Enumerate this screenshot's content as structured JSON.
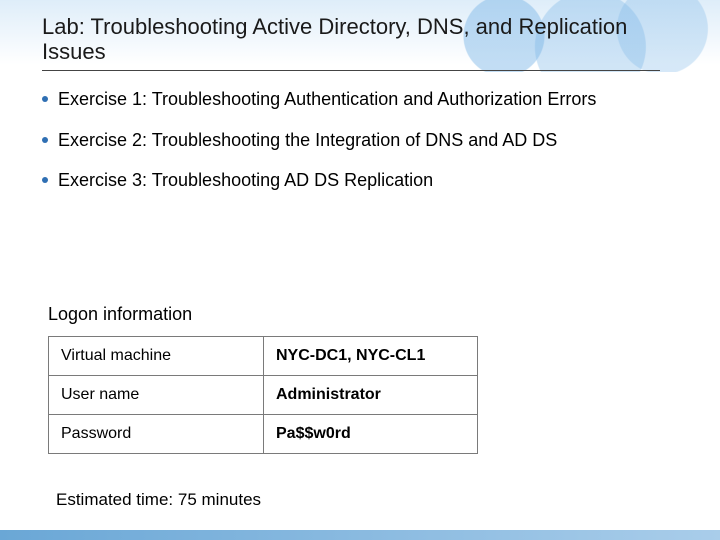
{
  "title": "Lab: Troubleshooting Active Directory, DNS, and Replication Issues",
  "bullets": [
    "Exercise 1: Troubleshooting Authentication and Authorization Errors",
    "Exercise 2: Troubleshooting the Integration of DNS and AD DS",
    "Exercise 3: Troubleshooting AD DS Replication"
  ],
  "logon": {
    "heading": "Logon information",
    "rows": [
      {
        "key": "Virtual machine",
        "val": "NYC-DC1, NYC-CL1"
      },
      {
        "key": "User name",
        "val": "Administrator"
      },
      {
        "key": "Password",
        "val": "Pa$$w0rd"
      }
    ]
  },
  "estimate": "Estimated time: 75 minutes"
}
